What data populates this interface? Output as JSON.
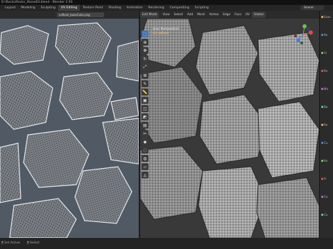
{
  "window": {
    "title": "D:\\Rocks\\Rocks_Stone03.blend - Blender 2.93"
  },
  "workspace_tabs": [
    "Layout",
    "Modeling",
    "Sculpting",
    "UV Editing",
    "Texture Paint",
    "Shading",
    "Animation",
    "Rendering",
    "Compositing",
    "Scripting"
  ],
  "active_tab": "UV Editing",
  "scene": "Scene",
  "uv_editor": {
    "image_name": "ceRock_baseColor.png"
  },
  "viewport": {
    "mode": "Edit Mode",
    "header_items": [
      "View",
      "Select",
      "Add",
      "Mesh",
      "Vertex",
      "Edge",
      "Face",
      "UV"
    ],
    "orientation": "Global",
    "label_line1": "User Perspective",
    "label_line2": "(1) ceRock"
  },
  "right_panel": {
    "rows": [
      "Scen",
      "Re",
      "Vi",
      "Re",
      "Ma",
      "Ba",
      "Re",
      "Cu",
      "Re",
      "Fr",
      "Ca",
      "Cu"
    ]
  },
  "statusbar": {
    "items": [
      "Set Active",
      "Select"
    ]
  },
  "colors": {
    "uv_background": "#505964",
    "viewport_background": "#393939",
    "accent": "#4772b3"
  }
}
